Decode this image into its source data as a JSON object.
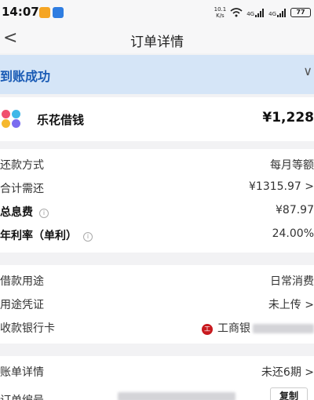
{
  "status_bar": {
    "time": "14:07",
    "net_speed_top": "10.1",
    "net_speed_bottom": "K/s",
    "signal_1": "4G",
    "signal_2": "4G",
    "battery": "77",
    "badge_color_1": "#f5a524",
    "badge_color_2": "#2f7de1"
  },
  "nav": {
    "back": "<",
    "title": "订单详情"
  },
  "banner": {
    "status": "到账成功",
    "chevron": "∨"
  },
  "lender": {
    "name": "乐花借钱",
    "amount": "¥1,228",
    "logo_colors": [
      "#f0506e",
      "#3fb8e8",
      "#f5b82e",
      "#7a6cf0"
    ]
  },
  "loan_info": [
    {
      "label": "还款方式",
      "value": "每月等额",
      "bold": false,
      "info": false
    },
    {
      "label": "合计需还",
      "value": "¥1315.97 >",
      "bold": false,
      "info": false
    },
    {
      "label": "总息费",
      "value": "¥87.97",
      "bold": true,
      "info": true
    },
    {
      "label": "年利率（单利）",
      "value": "24.00%",
      "bold": true,
      "info": true
    }
  ],
  "loan_details": {
    "purpose_label": "借款用途",
    "purpose_value": "日常消费",
    "proof_label": "用途凭证",
    "proof_value": "未上传 >",
    "bank_label": "收款银行卡",
    "bank_icon": "工",
    "bank_name": "工商银"
  },
  "bill": {
    "detail_label": "账单详情",
    "detail_value": "未还6期 >",
    "order_label": "订单编号",
    "copy_label": "复制"
  },
  "colors": {
    "accent": "#1a5bb5",
    "banner_bg": "#d5e5f7",
    "page_bg": "#f2f2f4"
  }
}
